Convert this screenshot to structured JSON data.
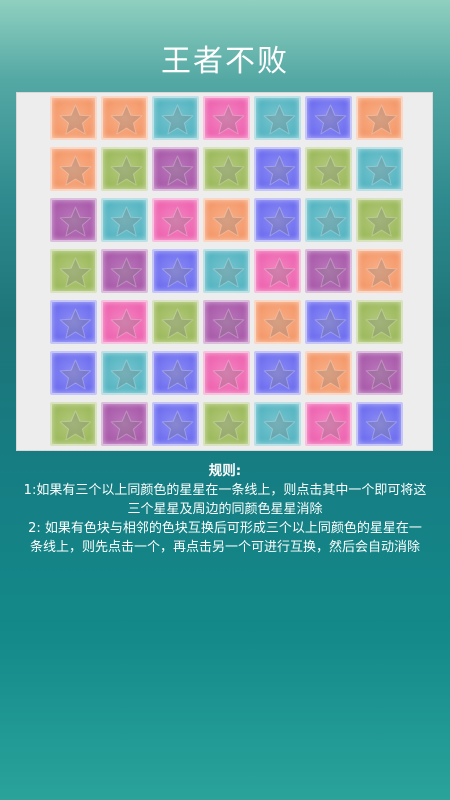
{
  "title": "王者不败",
  "board": {
    "rows": 7,
    "cols": 7,
    "cells": [
      [
        "orange",
        "orange",
        "teal",
        "pink",
        "teal",
        "blue",
        "orange"
      ],
      [
        "orange",
        "green",
        "purple",
        "green",
        "blue",
        "green",
        "teal"
      ],
      [
        "purple",
        "teal",
        "pink",
        "orange",
        "blue",
        "teal",
        "green"
      ],
      [
        "green",
        "purple",
        "blue",
        "teal",
        "pink",
        "purple",
        "orange"
      ],
      [
        "blue",
        "pink",
        "green",
        "purple",
        "orange",
        "blue",
        "green"
      ],
      [
        "blue",
        "teal",
        "blue",
        "pink",
        "blue",
        "orange",
        "purple"
      ],
      [
        "green",
        "purple",
        "blue",
        "green",
        "teal",
        "pink",
        "blue"
      ]
    ],
    "colors": {
      "orange": {
        "base": "#f4996a",
        "light": "#f9b08a"
      },
      "teal": {
        "base": "#55b5c2",
        "light": "#79c5cf"
      },
      "pink": {
        "base": "#ee64b0",
        "light": "#f386c2"
      },
      "blue": {
        "base": "#6e6ef0",
        "light": "#8e8ef4"
      },
      "green": {
        "base": "#9dba5c",
        "light": "#b3c97f"
      },
      "purple": {
        "base": "#a95aaa",
        "light": "#bb7abc"
      }
    },
    "star_icon": "star-icon"
  },
  "rules": {
    "heading": "规则:",
    "rule1_line1": "1:如果有三个以上同颜色的星星在一条线上，则点击其中一个即可将这",
    "rule1_line2": "三个星星及周边的同颜色星星消除",
    "rule2_line1": "2: 如果有色块与相邻的色块互换后可形成三个以上同颜色的星星在一",
    "rule2_line2": "条线上，则先点击一个，再点击另一个可进行互换，然后会自动消除"
  }
}
